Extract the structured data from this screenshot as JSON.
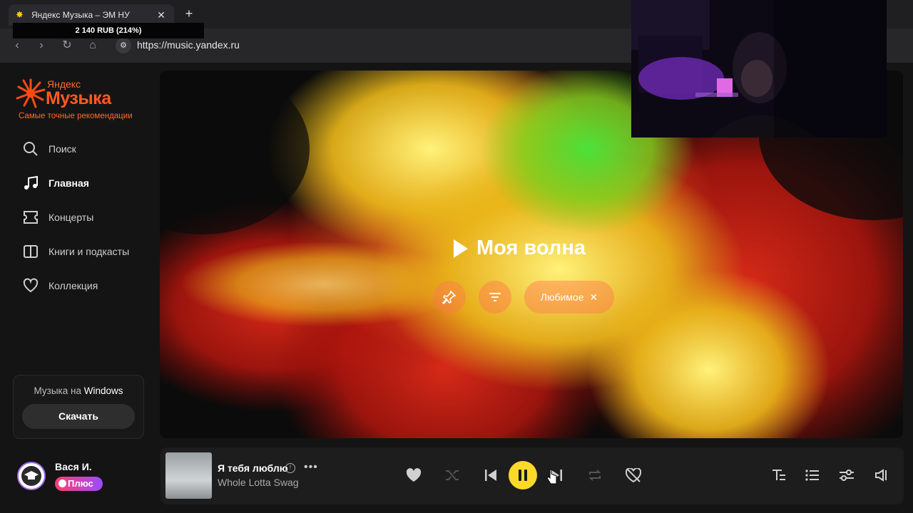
{
  "browser": {
    "tab_title": "Яндекс Музыка – ЭМ НУ",
    "new_tab": "+",
    "close": "✕",
    "price_overlay": "2 140 RUB (214%)",
    "url": "https://music.yandex.ru"
  },
  "sidebar": {
    "logo_small": "Яндекс",
    "logo_big": "Музыка",
    "tagline": "Самые точные рекомендации",
    "items": [
      {
        "label": "Поиск",
        "icon": "search-icon"
      },
      {
        "label": "Главная",
        "icon": "music-note-icon",
        "active": true
      },
      {
        "label": "Концерты",
        "icon": "ticket-icon"
      },
      {
        "label": "Книги и подкасты",
        "icon": "book-icon"
      },
      {
        "label": "Коллекция",
        "icon": "heart-icon"
      }
    ],
    "promo": {
      "text_prefix": "Музыка на ",
      "text_bold": "Windows",
      "button": "Скачать"
    },
    "user": {
      "name": "Вася И.",
      "badge": "Плюс"
    }
  },
  "hero": {
    "title": "Моя волна",
    "filter_chip": "Любимое"
  },
  "player": {
    "track": "Я тебя люблю",
    "artist": "Whole Lotta Swag"
  },
  "colors": {
    "accent": "#ffd92a",
    "brand": "#ff5a1e"
  }
}
